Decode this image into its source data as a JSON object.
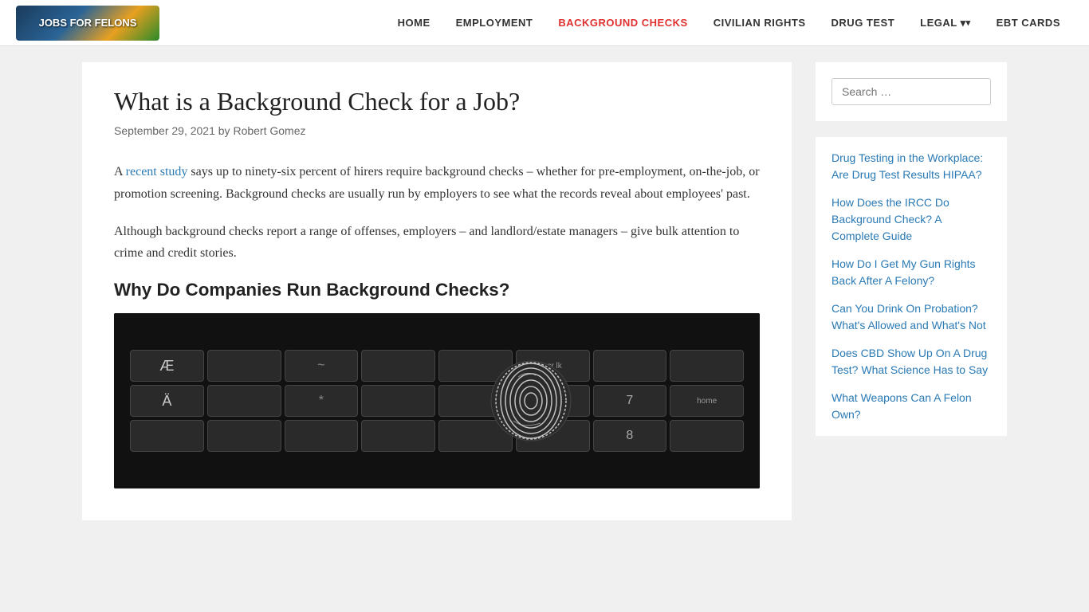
{
  "site": {
    "logo_text": "JOBS FOR FELONS",
    "logo_alt": "Jobs For Felons Hub"
  },
  "nav": {
    "links": [
      {
        "id": "home",
        "label": "HOME",
        "active": false,
        "has_arrow": false
      },
      {
        "id": "employment",
        "label": "EMPLOYMENT",
        "active": false,
        "has_arrow": false
      },
      {
        "id": "background-checks",
        "label": "BACKGROUND CHECKS",
        "active": true,
        "has_arrow": false
      },
      {
        "id": "civilian-rights",
        "label": "CIVILIAN RIGHTS",
        "active": false,
        "has_arrow": false
      },
      {
        "id": "drug-test",
        "label": "DRUG TEST",
        "active": false,
        "has_arrow": false
      },
      {
        "id": "legal",
        "label": "LEGAL",
        "active": false,
        "has_arrow": true
      },
      {
        "id": "ebt-cards",
        "label": "EBT CARDS",
        "active": false,
        "has_arrow": false
      }
    ]
  },
  "article": {
    "title": "What is a Background Check for a Job?",
    "date": "September 29, 2021",
    "by": "by",
    "author": "Robert Gomez",
    "para1_before_link": "A ",
    "para1_link": "recent study",
    "para1_after": " says up to ninety-six percent of hirers require background checks – whether for pre-employment, on-the-job, or promotion screening. Background checks are usually run by employers to see what the records reveal about employees' past.",
    "para2": "Although background checks report a range of offenses, employers – and landlord/estate managers – give bulk attention to crime and credit stories.",
    "section_heading": "Why Do Companies Run Background Checks?",
    "image_alt": "Keyboard with fingerprint"
  },
  "sidebar": {
    "search_placeholder": "Search …",
    "search_label": "Search",
    "related_links": [
      {
        "id": "drug-testing",
        "text": "Drug Testing in the Workplace: Are Drug Test Results HIPAA?"
      },
      {
        "id": "ircc",
        "text": "How Does the IRCC Do Background Check? A Complete Guide"
      },
      {
        "id": "gun-rights",
        "text": "How Do I Get My Gun Rights Back After A Felony?"
      },
      {
        "id": "drink-probation",
        "text": "Can You Drink On Probation? What's Allowed and What's Not"
      },
      {
        "id": "cbd-drug-test",
        "text": "Does CBD Show Up On A Drug Test? What Science Has to Say"
      },
      {
        "id": "weapons-felon",
        "text": "What Weapons Can A Felon Own?"
      }
    ]
  },
  "keyboard_keys": [
    {
      "label": "Æ"
    },
    {
      "label": ""
    },
    {
      "label": "~"
    },
    {
      "label": ""
    },
    {
      "label": ""
    },
    {
      "label": "scr lk"
    },
    {
      "label": ""
    },
    {
      "label": ""
    },
    {
      "label": "Ä"
    },
    {
      "label": ""
    },
    {
      "label": "*"
    },
    {
      "label": ""
    },
    {
      "label": ""
    },
    {
      "label": ""
    },
    {
      "label": "7"
    },
    {
      "label": "home"
    },
    {
      "label": ""
    },
    {
      "label": ""
    },
    {
      "label": ""
    },
    {
      "label": ""
    },
    {
      "label": ""
    },
    {
      "label": ""
    },
    {
      "label": "8"
    },
    {
      "label": ""
    }
  ]
}
